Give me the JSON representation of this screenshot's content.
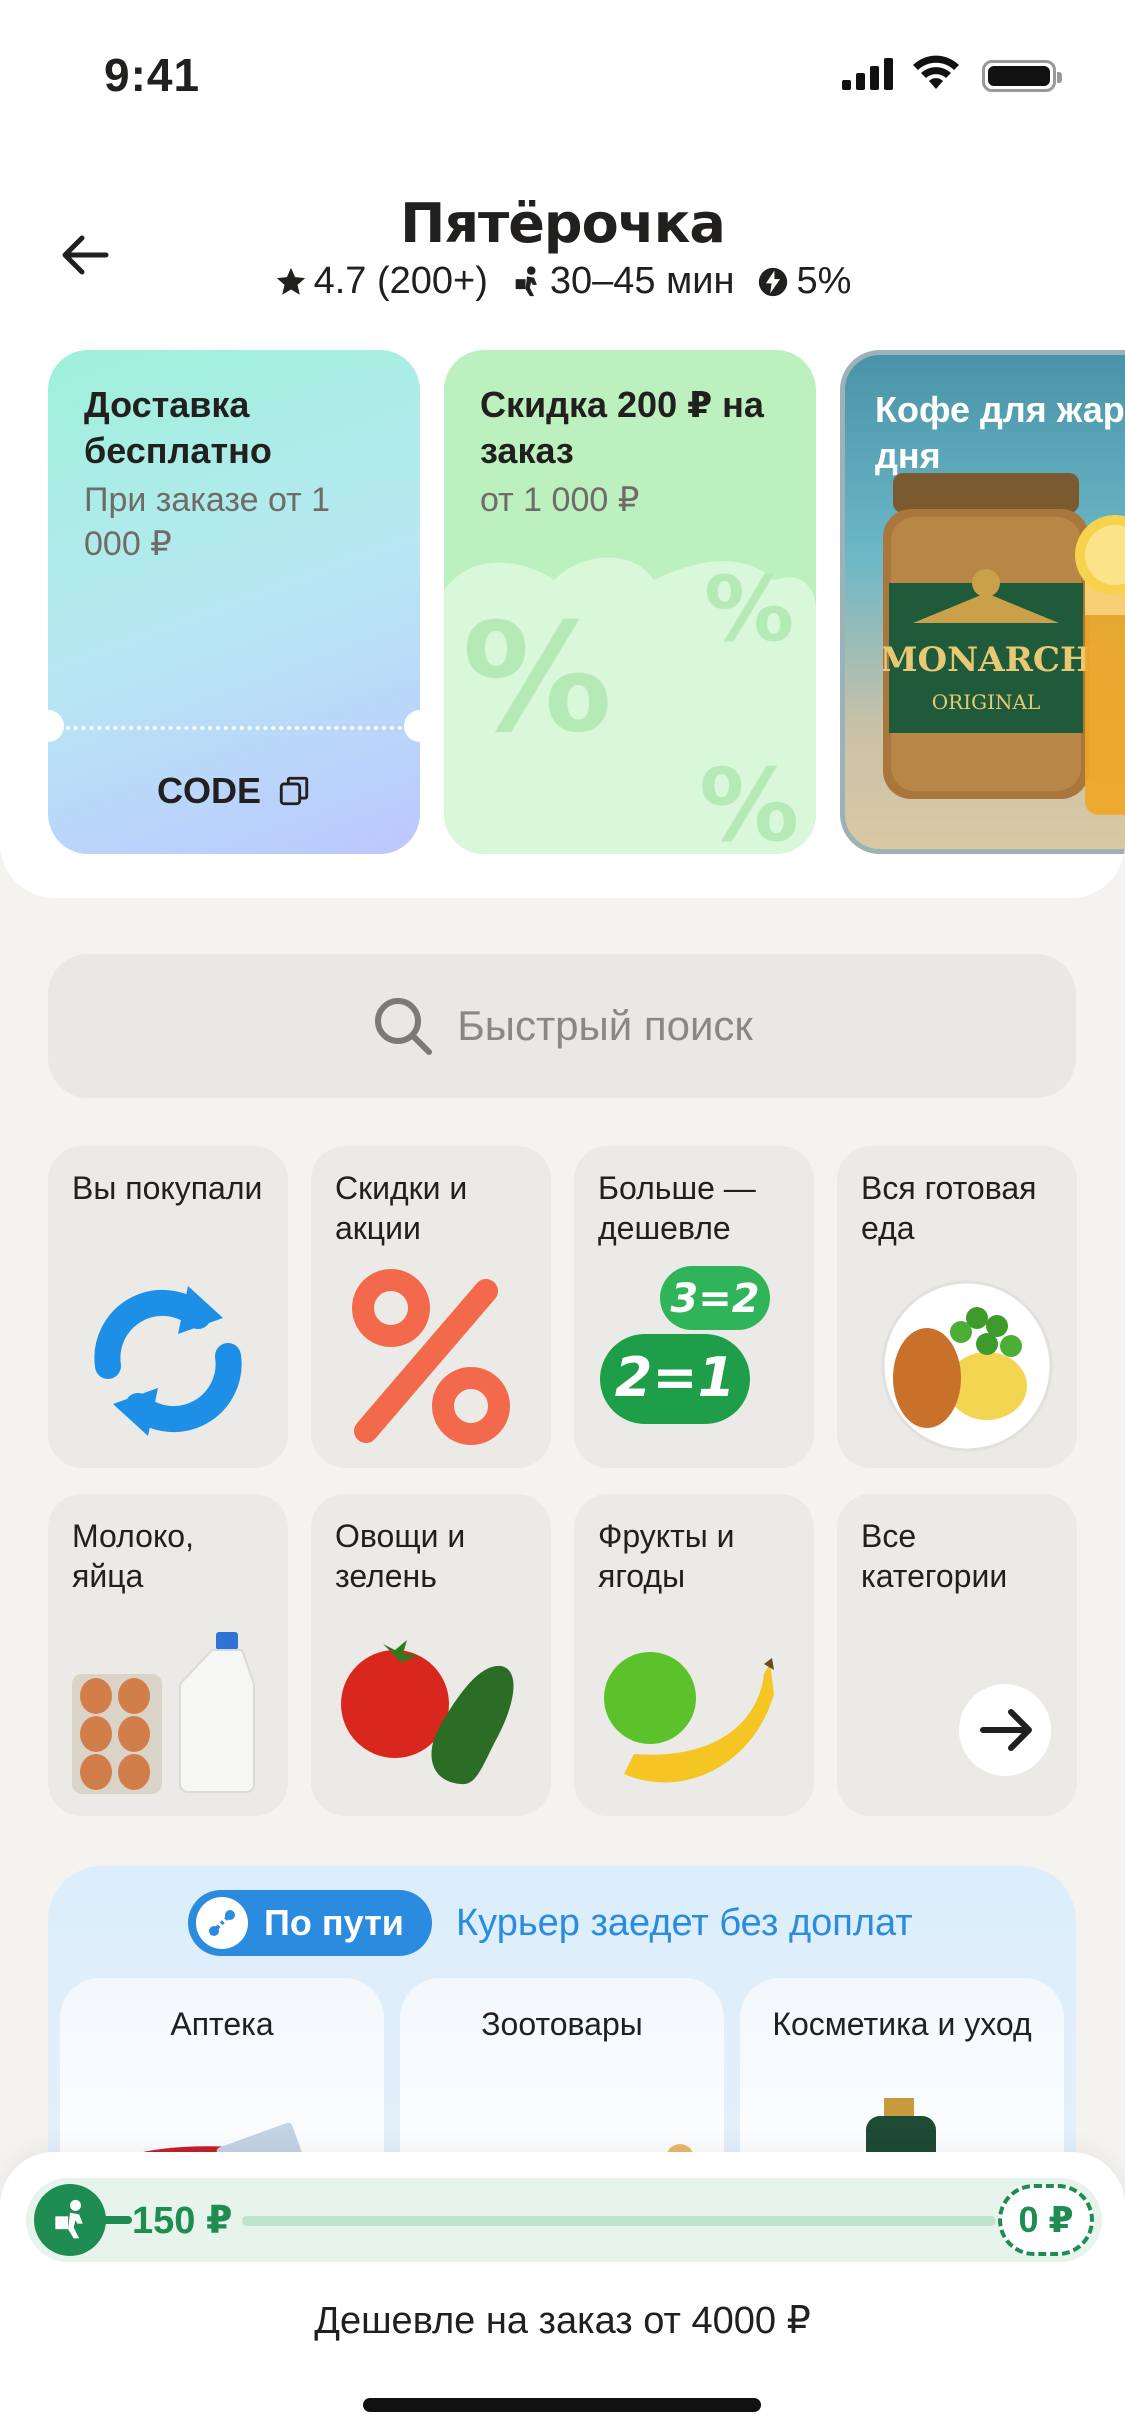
{
  "status_bar": {
    "time": "9:41"
  },
  "header": {
    "title": "Пятёрочка",
    "rating": "4.7 (200+)",
    "delivery_time": "30–45 мин",
    "cashback": "5%"
  },
  "promos": [
    {
      "title": "Доставка бесплатно",
      "subtitle": "При заказе от 1 000 ₽",
      "code": "CODE"
    },
    {
      "title": "Скидка 200 ₽ на заказ",
      "subtitle": "от 1 000 ₽"
    },
    {
      "title": "Кофе для жаркого дня",
      "brand": "MONARCH",
      "brand_sub": "ORIGINAL"
    }
  ],
  "search": {
    "placeholder": "Быстрый поиск"
  },
  "categories": [
    {
      "label": "Вы покупали",
      "icon": "refresh-icon"
    },
    {
      "label": "Скидки и акции",
      "icon": "percent-icon"
    },
    {
      "label": "Больше — дешевле",
      "icon": "bulk-deal-icon",
      "badge_1": "3=2",
      "badge_2": "2=1"
    },
    {
      "label": "Вся готовая еда",
      "icon": "ready-meal-icon"
    },
    {
      "label": "Молоко, яйца",
      "icon": "milk-eggs-icon"
    },
    {
      "label": "Овощи и зелень",
      "icon": "vegetables-icon"
    },
    {
      "label": "Фрукты и ягоды",
      "icon": "fruits-icon"
    },
    {
      "label": "Все категории",
      "icon": "arrow-right-icon"
    }
  ],
  "on_the_way": {
    "label": "По пути",
    "note": "Курьер заедет без доплат",
    "stores": [
      {
        "name": "Аптека"
      },
      {
        "name": "Зоотовары"
      },
      {
        "name": "Косметика и уход"
      }
    ]
  },
  "delivery_progress": {
    "current": "150 ₽",
    "goal": "0 ₽",
    "fill_fraction": 0.0,
    "message": "Дешевле на заказ от 4000 ₽"
  },
  "colors": {
    "accent_green": "#1f8c52",
    "accent_blue": "#2a8bdf",
    "text": "#21201f"
  }
}
